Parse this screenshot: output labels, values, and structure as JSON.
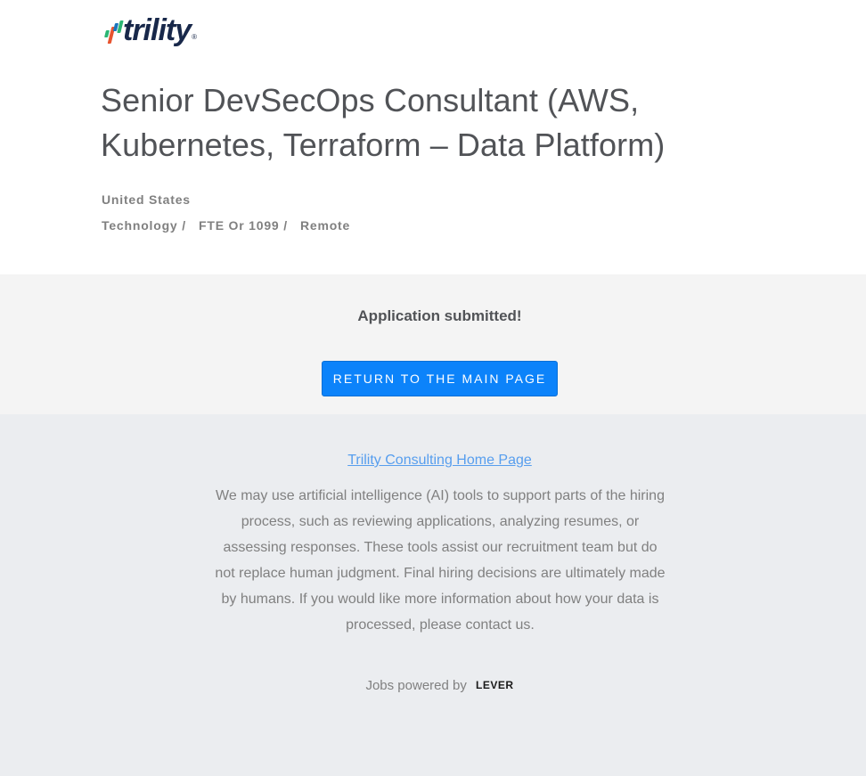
{
  "brand": {
    "logo_text": "trility",
    "logo_mark": "®",
    "accent_colors": [
      "#2bb673",
      "#e8542f",
      "#1a75bc"
    ]
  },
  "job": {
    "title": "Senior DevSecOps Consultant (AWS, Kubernetes, Terraform – Data Platform)",
    "location": "United States",
    "categories": [
      {
        "label": "Technology",
        "separator": " /   "
      },
      {
        "label": "FTE Or 1099",
        "separator": " /   "
      },
      {
        "label": "Remote",
        "separator": ""
      }
    ]
  },
  "confirmation": {
    "message": "Application submitted!",
    "return_button_label": "RETURN TO THE MAIN PAGE"
  },
  "footer": {
    "home_link": "Trility Consulting Home Page",
    "ai_notice": "We may use artificial intelligence (AI) tools to support parts of the hiring process, such as reviewing applications, analyzing resumes, or assessing responses. These tools assist our recruitment team but do not replace human judgment. Final hiring decisions are ultimately made by humans. If you would like more information about how your data is processed, please contact us.",
    "powered_by": "Jobs powered by",
    "powered_logo": "LEVER"
  },
  "colors": {
    "primary_button": "#0c83fa",
    "link": "#579eee",
    "title_text": "#515357"
  }
}
